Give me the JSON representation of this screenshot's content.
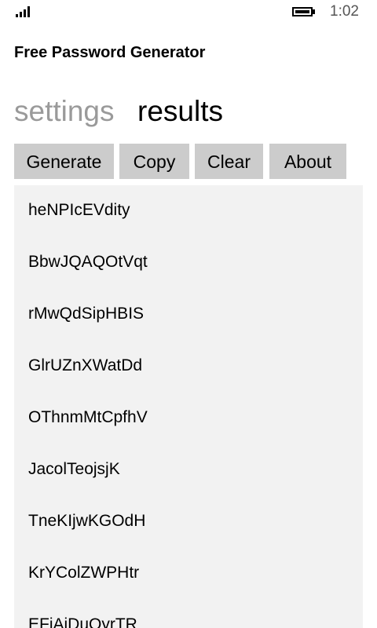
{
  "status_bar": {
    "signal_icon": "signal-strength-icon",
    "battery_icon": "battery-icon",
    "time": "1:02"
  },
  "app": {
    "title": "Free Password Generator"
  },
  "pivot": {
    "tabs": [
      {
        "label": "settings",
        "active": false
      },
      {
        "label": "results",
        "active": true
      }
    ]
  },
  "toolbar": {
    "generate_label": "Generate",
    "copy_label": "Copy",
    "clear_label": "Clear",
    "about_label": "About"
  },
  "results": {
    "passwords": [
      "heNPIcEVdity",
      "BbwJQAQOtVqt",
      "rMwQdSipHBIS",
      "GlrUZnXWatDd",
      "OThnmMtCpfhV",
      "JacolTeojsjK",
      "TneKIjwKGOdH",
      "KrYColZWPHtr",
      "EFjAjDuQyrTR"
    ]
  },
  "colors": {
    "button_bg": "#cccccc",
    "list_bg": "#f2f2f2",
    "inactive_tab": "#9a9a9a",
    "text": "#000000"
  }
}
